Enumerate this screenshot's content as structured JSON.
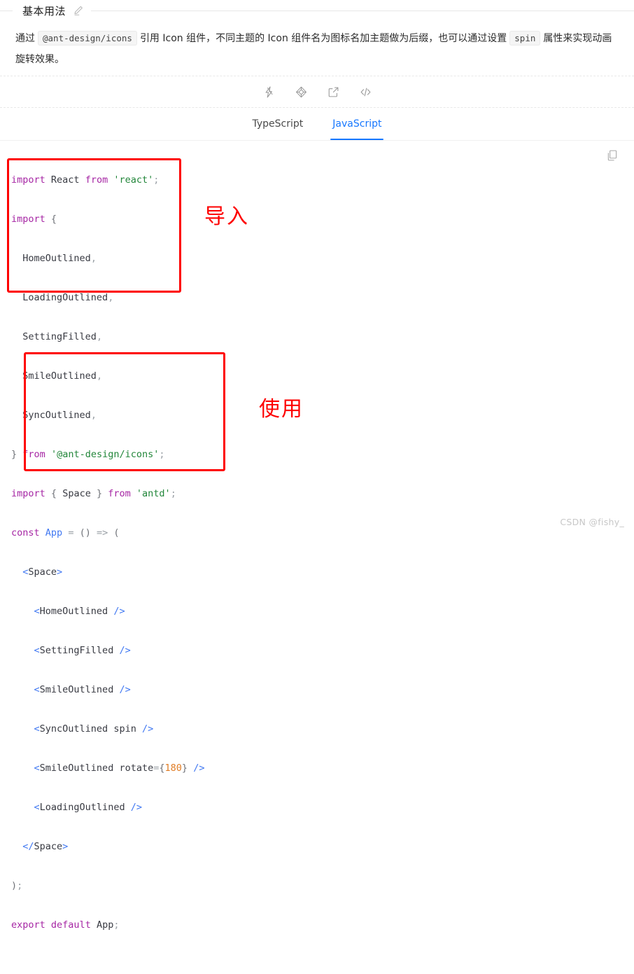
{
  "section": {
    "title": "基本用法",
    "edit_icon": "pencil-edit-icon"
  },
  "description": {
    "part1": "通过",
    "chip1": "@ant-design/icons",
    "part2": "引用 Icon 组件，不同主题的 Icon 组件名为图标名加主题做为后缀，也可以通过设置",
    "chip2": "spin",
    "part3": "属性来实现动画旋转效果。"
  },
  "toolbar": {
    "icons": [
      {
        "name": "thunderbolt-icon",
        "title": "在 StackBlitz 中打开"
      },
      {
        "name": "codesandbox-icon",
        "title": "在 CodeSandbox 中打开"
      },
      {
        "name": "external-link-icon",
        "title": "在外部打开"
      },
      {
        "name": "code-brackets-icon",
        "title": "显示代码"
      }
    ]
  },
  "tabs": [
    {
      "label": "TypeScript",
      "active": false
    },
    {
      "label": "JavaScript",
      "active": true
    }
  ],
  "code_panel": {
    "copy_icon": "copy-icon",
    "accent_color": "#1677ff",
    "lines": [
      "import React from 'react';",
      "import {",
      "  HomeOutlined,",
      "  LoadingOutlined,",
      "  SettingFilled,",
      "  SmileOutlined,",
      "  SyncOutlined,",
      "} from '@ant-design/icons';",
      "import { Space } from 'antd';",
      "const App = () => (",
      "  <Space>",
      "    <HomeOutlined />",
      "    <SettingFilled />",
      "    <SmileOutlined />",
      "    <SyncOutlined spin />",
      "    <SmileOutlined rotate={180} />",
      "    <LoadingOutlined />",
      "  </Space>",
      ");",
      "export default App;"
    ]
  },
  "annotations": {
    "color": "#fe0000",
    "box_import_label": "导入",
    "box_usage_label": "使用"
  },
  "watermark": "CSDN @fishy_"
}
